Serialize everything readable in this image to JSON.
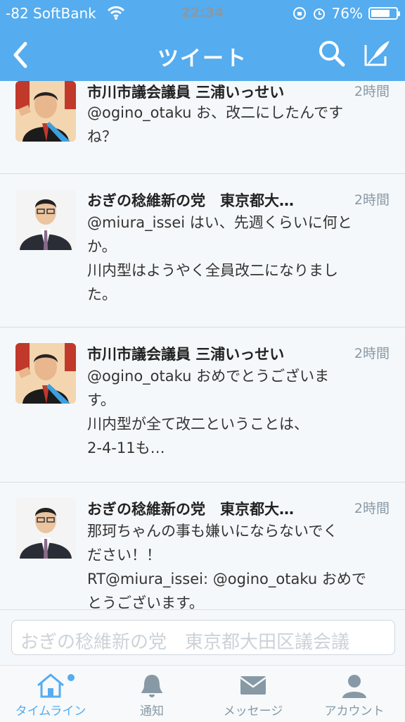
{
  "status_bar": {
    "carrier": "-82 SoftBank",
    "time": "22:34",
    "battery_percent": "76%",
    "battery_level": 0.76
  },
  "header": {
    "title": "ツイート",
    "back_icon": "chevron-left-icon",
    "search_icon": "search-icon",
    "compose_icon": "compose-icon",
    "color": "#55acee"
  },
  "tweets": [
    {
      "name": "市川市議会議員 三浦いっせい",
      "time": "2時間",
      "lines": [
        "@ogino_otaku お、改二にしたんです",
        "ね？"
      ]
    },
    {
      "name": "おぎの稔維新の党　東京都大…",
      "time": "2時間",
      "lines": [
        "@miura_issei はい、先週くらいに何と",
        "か。",
        "川内型はようやく全員改二になりまし",
        "た。"
      ]
    },
    {
      "name": "市川市議会議員 三浦いっせい",
      "time": "2時間",
      "lines": [
        "@ogino_otaku おめでとうございま",
        "す。",
        "川内型が全て改二ということは、",
        "2-4-11も…"
      ]
    },
    {
      "name": "おぎの稔維新の党　東京都大…",
      "time": "2時間",
      "lines": [
        "那珂ちゃんの事も嫌いにならないでく",
        "ださい！！",
        "RT@miura_issei: @ogino_otaku おめで",
        "とうございます。"
      ]
    }
  ],
  "compose": {
    "placeholder": "おぎの稔維新の党　東京都大田区議会議"
  },
  "tabs": [
    {
      "label": "タイムライン",
      "icon": "home-icon",
      "active": true
    },
    {
      "label": "通知",
      "icon": "bell-icon",
      "active": false
    },
    {
      "label": "メッセージ",
      "icon": "envelope-icon",
      "active": false
    },
    {
      "label": "アカウント",
      "icon": "person-icon",
      "active": false
    }
  ]
}
